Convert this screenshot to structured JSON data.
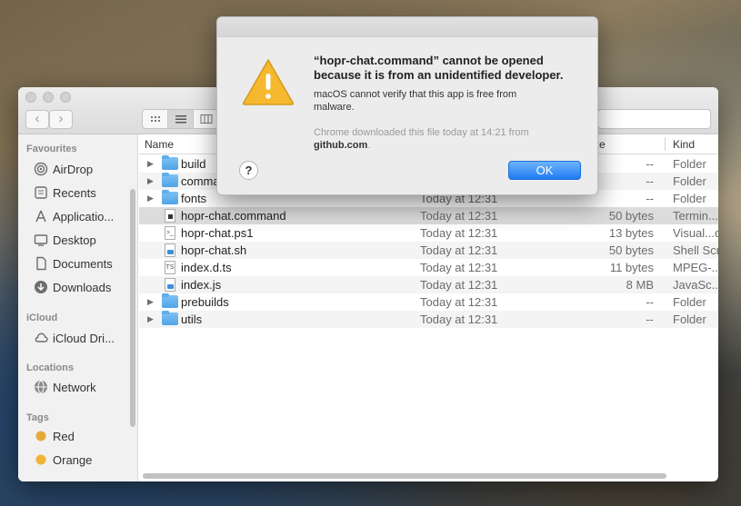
{
  "finder": {
    "sidebar": {
      "favourites_heading": "Favourites",
      "favourites": [
        {
          "label": "AirDrop",
          "icon": "airdrop-icon"
        },
        {
          "label": "Recents",
          "icon": "clock-icon"
        },
        {
          "label": "Applicatio...",
          "icon": "applications-icon"
        },
        {
          "label": "Desktop",
          "icon": "desktop-icon"
        },
        {
          "label": "Documents",
          "icon": "documents-icon"
        },
        {
          "label": "Downloads",
          "icon": "downloads-icon"
        }
      ],
      "icloud_heading": "iCloud",
      "icloud": [
        {
          "label": "iCloud Dri...",
          "icon": "cloud-icon"
        }
      ],
      "locations_heading": "Locations",
      "locations": [
        {
          "label": "Network",
          "icon": "network-icon"
        }
      ],
      "tags_heading": "Tags",
      "tags": [
        {
          "label": "Red",
          "color": "#e5a93a"
        },
        {
          "label": "Orange",
          "color": "#f0b534"
        }
      ]
    },
    "columns": {
      "name": "Name",
      "size": "ze",
      "kind": "Kind"
    },
    "rows": [
      {
        "name": "build",
        "date": "",
        "size": "--",
        "kind": "Folder",
        "type": "folder"
      },
      {
        "name": "comma",
        "date": "",
        "size": "--",
        "kind": "Folder",
        "type": "folder"
      },
      {
        "name": "fonts",
        "date": "Today at 12:31",
        "size": "--",
        "kind": "Folder",
        "type": "folder"
      },
      {
        "name": "hopr-chat.command",
        "date": "Today at 12:31",
        "size": "50 bytes",
        "kind": "Termin...",
        "type": "doc"
      },
      {
        "name": "hopr-chat.ps1",
        "date": "Today at 12:31",
        "size": "13 bytes",
        "kind": "Visual...o",
        "type": "doc"
      },
      {
        "name": "hopr-chat.sh",
        "date": "Today at 12:31",
        "size": "50 bytes",
        "kind": "Shell Scr",
        "type": "doc"
      },
      {
        "name": "index.d.ts",
        "date": "Today at 12:31",
        "size": "11 bytes",
        "kind": "MPEG-...",
        "type": "doc"
      },
      {
        "name": "index.js",
        "date": "Today at 12:31",
        "size": "8 MB",
        "kind": "JavaSc...",
        "type": "doc"
      },
      {
        "name": "prebuilds",
        "date": "Today at 12:31",
        "size": "--",
        "kind": "Folder",
        "type": "folder"
      },
      {
        "name": "utils",
        "date": "Today at 12:31",
        "size": "--",
        "kind": "Folder",
        "type": "folder"
      }
    ]
  },
  "alert": {
    "title": "“hopr-chat.command” cannot be opened because it is from an unidentified developer.",
    "message": "macOS cannot verify that this app is free from malware.",
    "note_prefix": "Chrome downloaded this file today at 14:21 from",
    "note_source": "github.com",
    "note_suffix": ".",
    "help_label": "?",
    "ok_label": "OK",
    "accent": "#1e7cf2",
    "warning_color": "#f5b82e"
  }
}
